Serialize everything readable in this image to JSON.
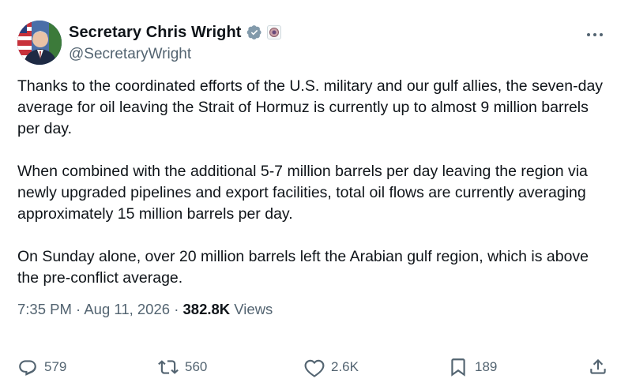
{
  "author": {
    "display_name": "Secretary Chris Wright",
    "handle": "@SecretaryWright",
    "verified": true
  },
  "tweet": {
    "paragraphs": [
      "Thanks to the coordinated efforts of the U.S. military and our gulf allies, the seven-day average for oil leaving the Strait of Hormuz is currently up to almost 9 million barrels per day.",
      "When combined with the additional 5-7 million barrels per day leaving the region via newly upgraded pipelines and export facilities, total oil flows are currently averaging approximately 15 million barrels per day.",
      "On Sunday alone, over 20 million barrels left the Arabian gulf region, which is above the pre-conflict average."
    ],
    "time": "7:35 PM",
    "date": "Aug 11, 2026",
    "separator": "·",
    "views_count": "382.8K",
    "views_label": "Views"
  },
  "actions": {
    "replies": "579",
    "reposts": "560",
    "likes": "2.6K",
    "bookmarks": "189"
  },
  "icons": {
    "more": "more-horizontal-icon",
    "verified": "verified-badge-icon",
    "affiliation": "government-seal-icon",
    "reply": "reply-icon",
    "repost": "repost-icon",
    "like": "heart-icon",
    "bookmark": "bookmark-icon",
    "share": "share-icon"
  },
  "colors": {
    "text_primary": "#0f1419",
    "text_secondary": "#536471",
    "verified_badge": "#829aab"
  }
}
